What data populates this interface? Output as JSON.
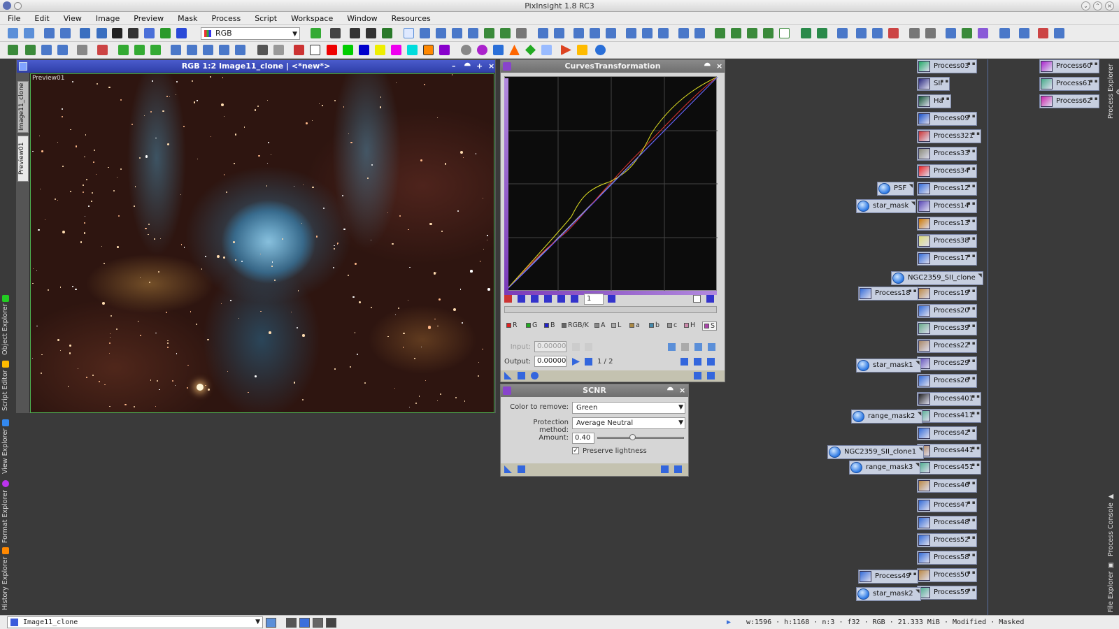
{
  "app": {
    "title": "PixInsight 1.8 RC3"
  },
  "menu": [
    "File",
    "Edit",
    "View",
    "Image",
    "Preview",
    "Mask",
    "Process",
    "Script",
    "Workspace",
    "Window",
    "Resources"
  ],
  "toolbar": {
    "channel_select": "RGB"
  },
  "left_tabs": [
    "Object Explorer",
    "Script Editor",
    "View Explorer",
    "Format Explorer",
    "History Explorer"
  ],
  "right_tabs": [
    "Process Explorer",
    "Process Console",
    "File Explorer"
  ],
  "image_window": {
    "title": "RGB 1:2 Image11_clone | <*new*>",
    "tabs": [
      "Image11_clone",
      "Preview01"
    ],
    "preview_label": "Preview01"
  },
  "curves": {
    "title": "CurvesTransformation",
    "zoom_value": "1",
    "channels": [
      {
        "label": "R",
        "color": "#d22"
      },
      {
        "label": "G",
        "color": "#2a2"
      },
      {
        "label": "B",
        "color": "#22c"
      },
      {
        "label": "RGB/K",
        "color": "#666"
      },
      {
        "label": "A",
        "color": "#888"
      },
      {
        "label": "L",
        "color": "#aaa"
      },
      {
        "label": "a",
        "color": "#a84"
      },
      {
        "label": "b",
        "color": "#48a"
      },
      {
        "label": "c",
        "color": "#999"
      },
      {
        "label": "H",
        "color": "#c8a"
      },
      {
        "label": "S",
        "color": "#a4a"
      }
    ],
    "input_label": "Input:",
    "input_value": "0.00000",
    "output_label": "Output:",
    "output_value": "0.00000",
    "point_index": "1 / 2"
  },
  "scnr": {
    "title": "SCNR",
    "color_label": "Color to remove:",
    "color_value": "Green",
    "method_label": "Protection method:",
    "method_value": "Average Neutral",
    "amount_label": "Amount:",
    "amount_value": "0.40",
    "amount_fraction": 0.4,
    "preserve_label": "Preserve lightness",
    "preserve_checked": true
  },
  "process_icons": [
    "Process03",
    "SII",
    "Ha",
    "Process09",
    "Process321",
    "Process33",
    "Process34",
    "Process12",
    "Process14",
    "Process13",
    "Process38",
    "Process17",
    "Process19",
    "Process20",
    "Process39",
    "Process22",
    "Process29",
    "Process26",
    "Process401",
    "Process411",
    "Process42",
    "Process441",
    "Process451",
    "Process46",
    "Process47",
    "Process48",
    "Process52",
    "Process58",
    "Process50",
    "Process59"
  ],
  "side_icons": [
    "PSF",
    "star_mask",
    "NGC2359_SII_clone",
    "Process18",
    "star_mask1",
    "range_mask2",
    "NGC2359_SII_clone1",
    "range_mask3",
    "Process49",
    "star_mask2"
  ],
  "far_icons": [
    "Process60",
    "Process61",
    "Process62"
  ],
  "status": {
    "view": "Image11_clone",
    "info": "w:1596 · h:1168 · n:3 · f32 · RGB · 21.333 MiB · Modified · Masked"
  }
}
